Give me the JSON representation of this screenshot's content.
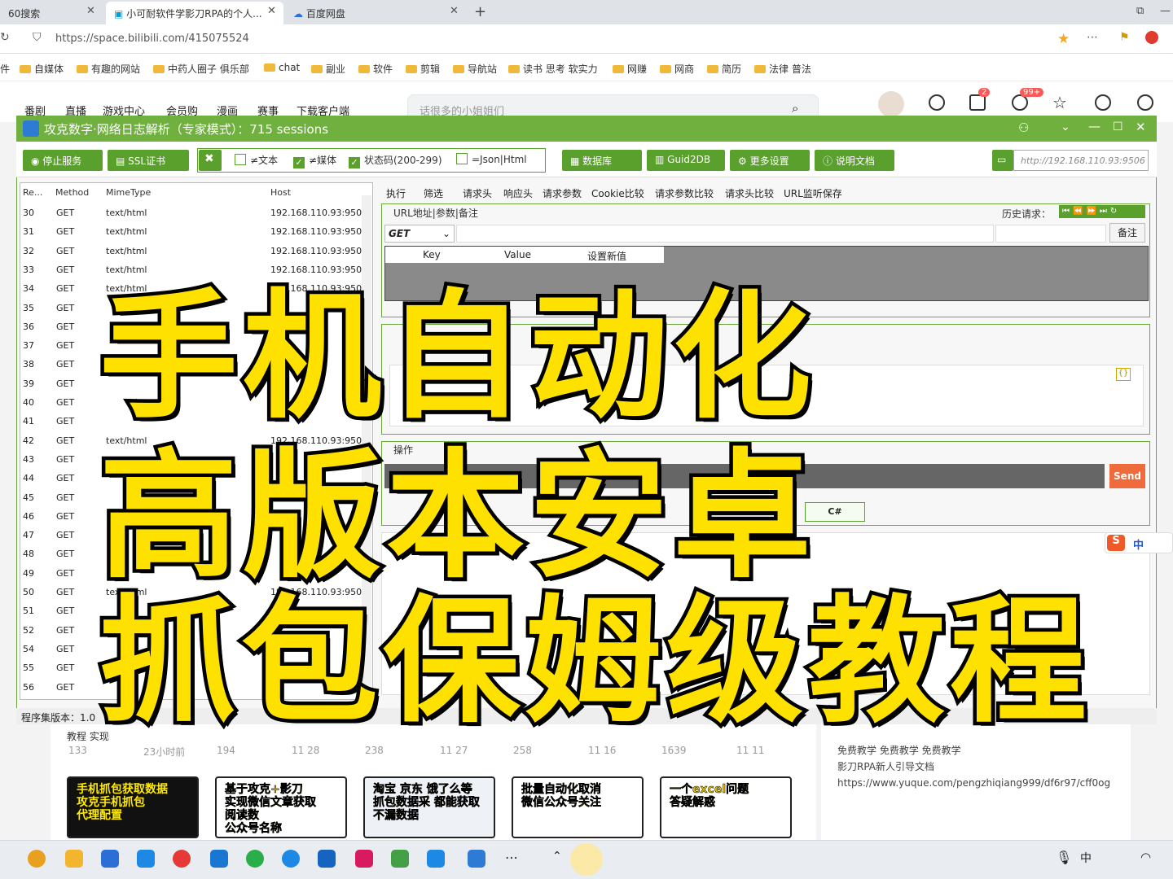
{
  "browser": {
    "tabs": [
      {
        "label": "60搜索",
        "active": false
      },
      {
        "label": "小可耐软件学影刀RPA的个人...",
        "active": true
      },
      {
        "label": "百度网盘",
        "active": false
      }
    ],
    "url": "https://space.bilibili.com/415075524",
    "bookmarks": [
      "件",
      "自媒体",
      "有趣的网站",
      "中药人圈子 俱乐部",
      "chat",
      "副业",
      "软件",
      "剪辑",
      "导航站",
      "读书 思考 软实力",
      "网赚",
      "网商",
      "简历",
      "法律 普法"
    ]
  },
  "site": {
    "nav": [
      "番剧",
      "直播",
      "游戏中心",
      "会员购",
      "漫画",
      "赛事",
      "下载客户端"
    ],
    "search_placeholder": "话很多的小姐姐们",
    "badges": {
      "messages": "2",
      "dynamic": "99+"
    }
  },
  "app": {
    "title": "攻克数字·网络日志解析（专家模式）：715 sessions",
    "toolbar": {
      "stop": "停止服务",
      "ssl": "SSL证书",
      "filters": [
        {
          "label": "≠文本",
          "checked": false
        },
        {
          "label": "≠媒体",
          "checked": true
        },
        {
          "label": "状态码(200-299)",
          "checked": true
        },
        {
          "label": "=Json|Html",
          "checked": false
        }
      ],
      "db": "数据库",
      "guid": "Guid2DB",
      "settings": "更多设置",
      "docs": "说明文档",
      "server_url": "http://192.168.110.93:9506"
    },
    "list": {
      "headers": [
        "Re...",
        "Method",
        "MimeType",
        "Host"
      ],
      "rows": [
        {
          "id": "30",
          "m": "GET",
          "mime": "text/html",
          "host": "192.168.110.93:9506"
        },
        {
          "id": "31",
          "m": "GET",
          "mime": "text/html",
          "host": "192.168.110.93:9506"
        },
        {
          "id": "32",
          "m": "GET",
          "mime": "text/html",
          "host": "192.168.110.93:9506"
        },
        {
          "id": "33",
          "m": "GET",
          "mime": "text/html",
          "host": "192.168.110.93:9506"
        },
        {
          "id": "34",
          "m": "GET",
          "mime": "text/html",
          "host": "192.168.110.93:9506"
        },
        {
          "id": "35",
          "m": "GET",
          "mime": "",
          "host": ""
        },
        {
          "id": "36",
          "m": "GET",
          "mime": "",
          "host": ""
        },
        {
          "id": "37",
          "m": "GET",
          "mime": "",
          "host": ""
        },
        {
          "id": "38",
          "m": "GET",
          "mime": "",
          "host": ""
        },
        {
          "id": "39",
          "m": "GET",
          "mime": "",
          "host": ""
        },
        {
          "id": "40",
          "m": "GET",
          "mime": "",
          "host": ""
        },
        {
          "id": "41",
          "m": "GET",
          "mime": "",
          "host": ""
        },
        {
          "id": "42",
          "m": "GET",
          "mime": "text/html",
          "host": "192.168.110.93:9506"
        },
        {
          "id": "43",
          "m": "GET",
          "mime": "",
          "host": ""
        },
        {
          "id": "44",
          "m": "GET",
          "mime": "",
          "host": ""
        },
        {
          "id": "45",
          "m": "GET",
          "mime": "",
          "host": ""
        },
        {
          "id": "46",
          "m": "GET",
          "mime": "",
          "host": ""
        },
        {
          "id": "47",
          "m": "GET",
          "mime": "",
          "host": ""
        },
        {
          "id": "48",
          "m": "GET",
          "mime": "",
          "host": ""
        },
        {
          "id": "49",
          "m": "GET",
          "mime": "",
          "host": ""
        },
        {
          "id": "50",
          "m": "GET",
          "mime": "text/html",
          "host": "192.168.110.93:9506"
        },
        {
          "id": "51",
          "m": "GET",
          "mime": "",
          "host": ""
        },
        {
          "id": "52",
          "m": "GET",
          "mime": "",
          "host": ""
        },
        {
          "id": "54",
          "m": "GET",
          "mime": "",
          "host": ""
        },
        {
          "id": "55",
          "m": "GET",
          "mime": "",
          "host": ""
        },
        {
          "id": "56",
          "m": "GET",
          "mime": "",
          "host": ""
        }
      ]
    },
    "tabs": [
      "执行",
      "筛选",
      "请求头",
      "响应头",
      "请求参数",
      "Cookie比较",
      "请求参数比较",
      "请求头比较",
      "URL监听保存"
    ],
    "url_group": "URL地址|参数|备注",
    "history_label": "历史请求：",
    "method": "GET",
    "note_button": "备注",
    "kv_headers": [
      "Key",
      "Value",
      "设置新值"
    ],
    "op_group": "操作",
    "send": "Send",
    "csharp": "C#",
    "status_prefix": "程序集版本：1.0"
  },
  "overlay": {
    "line1": "手机自动化",
    "line2": "高版本安卓",
    "line3": "抓包保姆级教程"
  },
  "videos": [
    {
      "title": "教程  实现",
      "plays": "133",
      "time": "23小时前",
      "thumb": "手机抓包获取数据\n攻克手机抓包\n代理配置"
    },
    {
      "title": "",
      "plays": "194",
      "time": "11 28",
      "thumb": "基于攻克+影刀\n实现微信文章获取\n阅读数\n公众号名称"
    },
    {
      "title": "",
      "plays": "238",
      "time": "11 27",
      "thumb": "淘宝 京东 饿了么等\n抓包数据采 都能获取\n不漏数据"
    },
    {
      "title": "",
      "plays": "258",
      "time": "11 16",
      "thumb": "批量自动化取消\n微信公众号关注"
    },
    {
      "title": "",
      "plays": "1639",
      "time": "11 11",
      "thumb": "一个excel问题\n答疑解惑"
    }
  ],
  "sidebar_text": [
    "免费教学 免费教学 免费教学",
    "影刀RPA新人引导文档",
    "https://www.yuque.com/pengzhiqiang999/df6r97/cff0og"
  ],
  "ime": "中"
}
